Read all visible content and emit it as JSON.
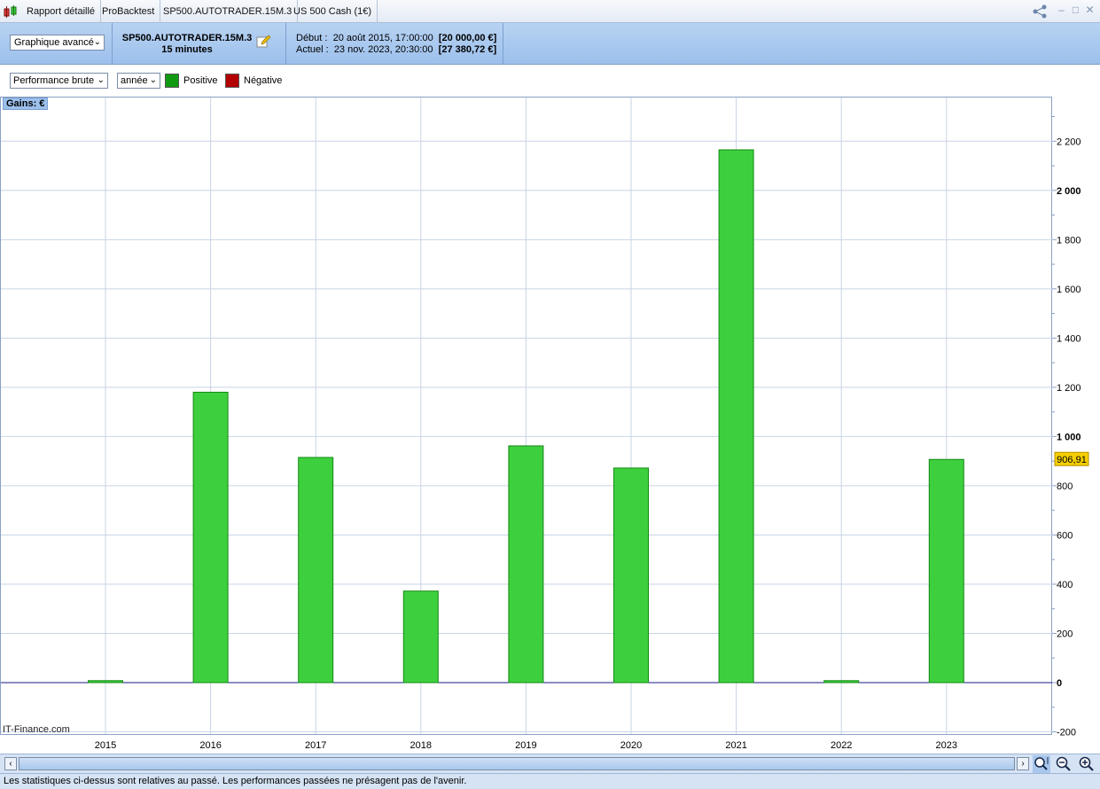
{
  "titlebar": {
    "tabs": [
      "Rapport détaillé",
      "ProBacktest",
      "SP500.AUTOTRADER.15M.3",
      "US 500 Cash (1€)"
    ]
  },
  "header": {
    "view_select": "Graphique avancé",
    "system_name": "SP500.AUTOTRADER.15M.3",
    "timeframe": "15 minutes",
    "start_label": "Début :",
    "start_date": "20 août 2015, 17:00:00",
    "start_value": "[20 000,00 €]",
    "current_label": "Actuel :",
    "current_date": "23 nov. 2023, 20:30:00",
    "current_value": "[27 380,72 €]"
  },
  "options": {
    "metric_select": "Performance brute",
    "period_select": "année",
    "positive_label": "Positive",
    "negative_label": "Négative",
    "positive_color": "#3ecf3e",
    "negative_color": "#b30000"
  },
  "chart_data": {
    "type": "bar",
    "title": "",
    "ylabel": "Gains: €",
    "categories": [
      "2015",
      "2016",
      "2017",
      "2018",
      "2019",
      "2020",
      "2021",
      "2022",
      "2023"
    ],
    "values": [
      8,
      1180,
      915,
      372,
      962,
      872,
      2165,
      8,
      906.91
    ],
    "ylim": [
      -200,
      2400
    ],
    "yticks": [
      -200,
      0,
      200,
      400,
      600,
      800,
      1000,
      1200,
      1400,
      1600,
      1800,
      2000,
      2200
    ],
    "ytick_labels": [
      "-200",
      "0",
      "200",
      "400",
      "600",
      "800",
      "1 000",
      "1 200",
      "1 400",
      "1 600",
      "1 800",
      "2 000",
      "2 200"
    ],
    "last_value_label": "906,91",
    "grid": true,
    "bar_color": "#3ecf3e"
  },
  "watermark": "IT-Finance.com",
  "footer": "Les statistiques ci-dessus sont relatives au passé. Les performances passées ne présagent pas de l'avenir."
}
